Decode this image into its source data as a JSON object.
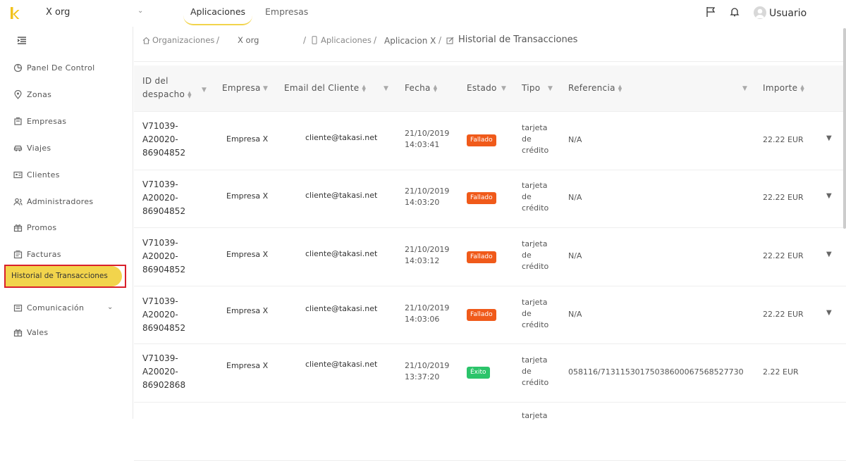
{
  "topbar": {
    "org": "X org",
    "tabs": [
      "Aplicaciones",
      "Empresas"
    ],
    "user": "Usuario"
  },
  "sidebar": {
    "items": [
      {
        "label": "Panel De Control",
        "icon": "dashboard-icon"
      },
      {
        "label": "Zonas",
        "icon": "location-icon"
      },
      {
        "label": "Empresas",
        "icon": "building-icon"
      },
      {
        "label": "Viajes",
        "icon": "car-icon"
      },
      {
        "label": "Clientes",
        "icon": "id-card-icon"
      },
      {
        "label": "Administradores",
        "icon": "admins-icon"
      },
      {
        "label": "Promos",
        "icon": "gift-icon"
      },
      {
        "label": "Facturas",
        "icon": "invoice-icon"
      }
    ],
    "active": "Historial de Transacciones",
    "after": [
      {
        "label": "Comunicación",
        "icon": "communication-icon"
      },
      {
        "label": "Vales",
        "icon": "voucher-icon"
      }
    ]
  },
  "breadcrumb": {
    "items": [
      "Organizaciones",
      "X org",
      "Aplicaciones",
      "Aplicacion X",
      "Historial de Transacciones"
    ],
    "separator": "/"
  },
  "table": {
    "columns": {
      "id_line1": "ID del",
      "id_line2": "despacho",
      "empresa": "Empresa",
      "email": "Email del Cliente",
      "fecha": "Fecha",
      "estado": "Estado",
      "tipo": "Tipo",
      "referencia": "Referencia",
      "importe": "Importe"
    },
    "rows": [
      {
        "id": [
          "V71039-",
          "A20020-",
          "86904852"
        ],
        "empresa": "Empresa X",
        "email": "cliente@takasi.net",
        "fecha": [
          "21/10/2019",
          "14:03:41"
        ],
        "estado": "Fallado",
        "tipo": [
          "tarjeta",
          "de",
          "crédito"
        ],
        "referencia": "N/A",
        "importe": "22.22 EUR"
      },
      {
        "id": [
          "V71039-",
          "A20020-",
          "86904852"
        ],
        "empresa": "Empresa X",
        "email": "cliente@takasi.net",
        "fecha": [
          "21/10/2019",
          "14:03:20"
        ],
        "estado": "Fallado",
        "tipo": [
          "tarjeta",
          "de",
          "crédito"
        ],
        "referencia": "N/A",
        "importe": "22.22 EUR"
      },
      {
        "id": [
          "V71039-",
          "A20020-",
          "86904852"
        ],
        "empresa": "Empresa X",
        "email": "cliente@takasi.net",
        "fecha": [
          "21/10/2019",
          "14:03:12"
        ],
        "estado": "Fallado",
        "tipo": [
          "tarjeta",
          "de",
          "crédito"
        ],
        "referencia": "N/A",
        "importe": "22.22 EUR"
      },
      {
        "id": [
          "V71039-",
          "A20020-",
          "86904852"
        ],
        "empresa": "Empresa X",
        "email": "cliente@takasi.net",
        "fecha": [
          "21/10/2019",
          "14:03:06"
        ],
        "estado": "Fallado",
        "tipo": [
          "tarjeta",
          "de",
          "crédito"
        ],
        "referencia": "N/A",
        "importe": "22.22 EUR"
      },
      {
        "id": [
          "V71039-",
          "A20020-",
          "86902868"
        ],
        "empresa": "Empresa X",
        "email": "cliente@takasi.net",
        "fecha": [
          "21/10/2019",
          "13:37:20"
        ],
        "estado": "Éxito",
        "tipo": [
          "tarjeta",
          "de",
          "crédito"
        ],
        "referencia": "058116/71311530175038600067568527730",
        "importe": "2.22 EUR"
      },
      {
        "id": [
          "",
          "",
          ""
        ],
        "empresa": "",
        "email": "",
        "fecha": [
          "",
          ""
        ],
        "estado": "",
        "tipo": [
          "tarjeta",
          "",
          ""
        ],
        "referencia": "",
        "importe": ""
      }
    ]
  },
  "colors": {
    "accent": "#f2d44c",
    "fail": "#f05a1a",
    "ok": "#2bc46a",
    "highlight_border": "#d9202b"
  }
}
